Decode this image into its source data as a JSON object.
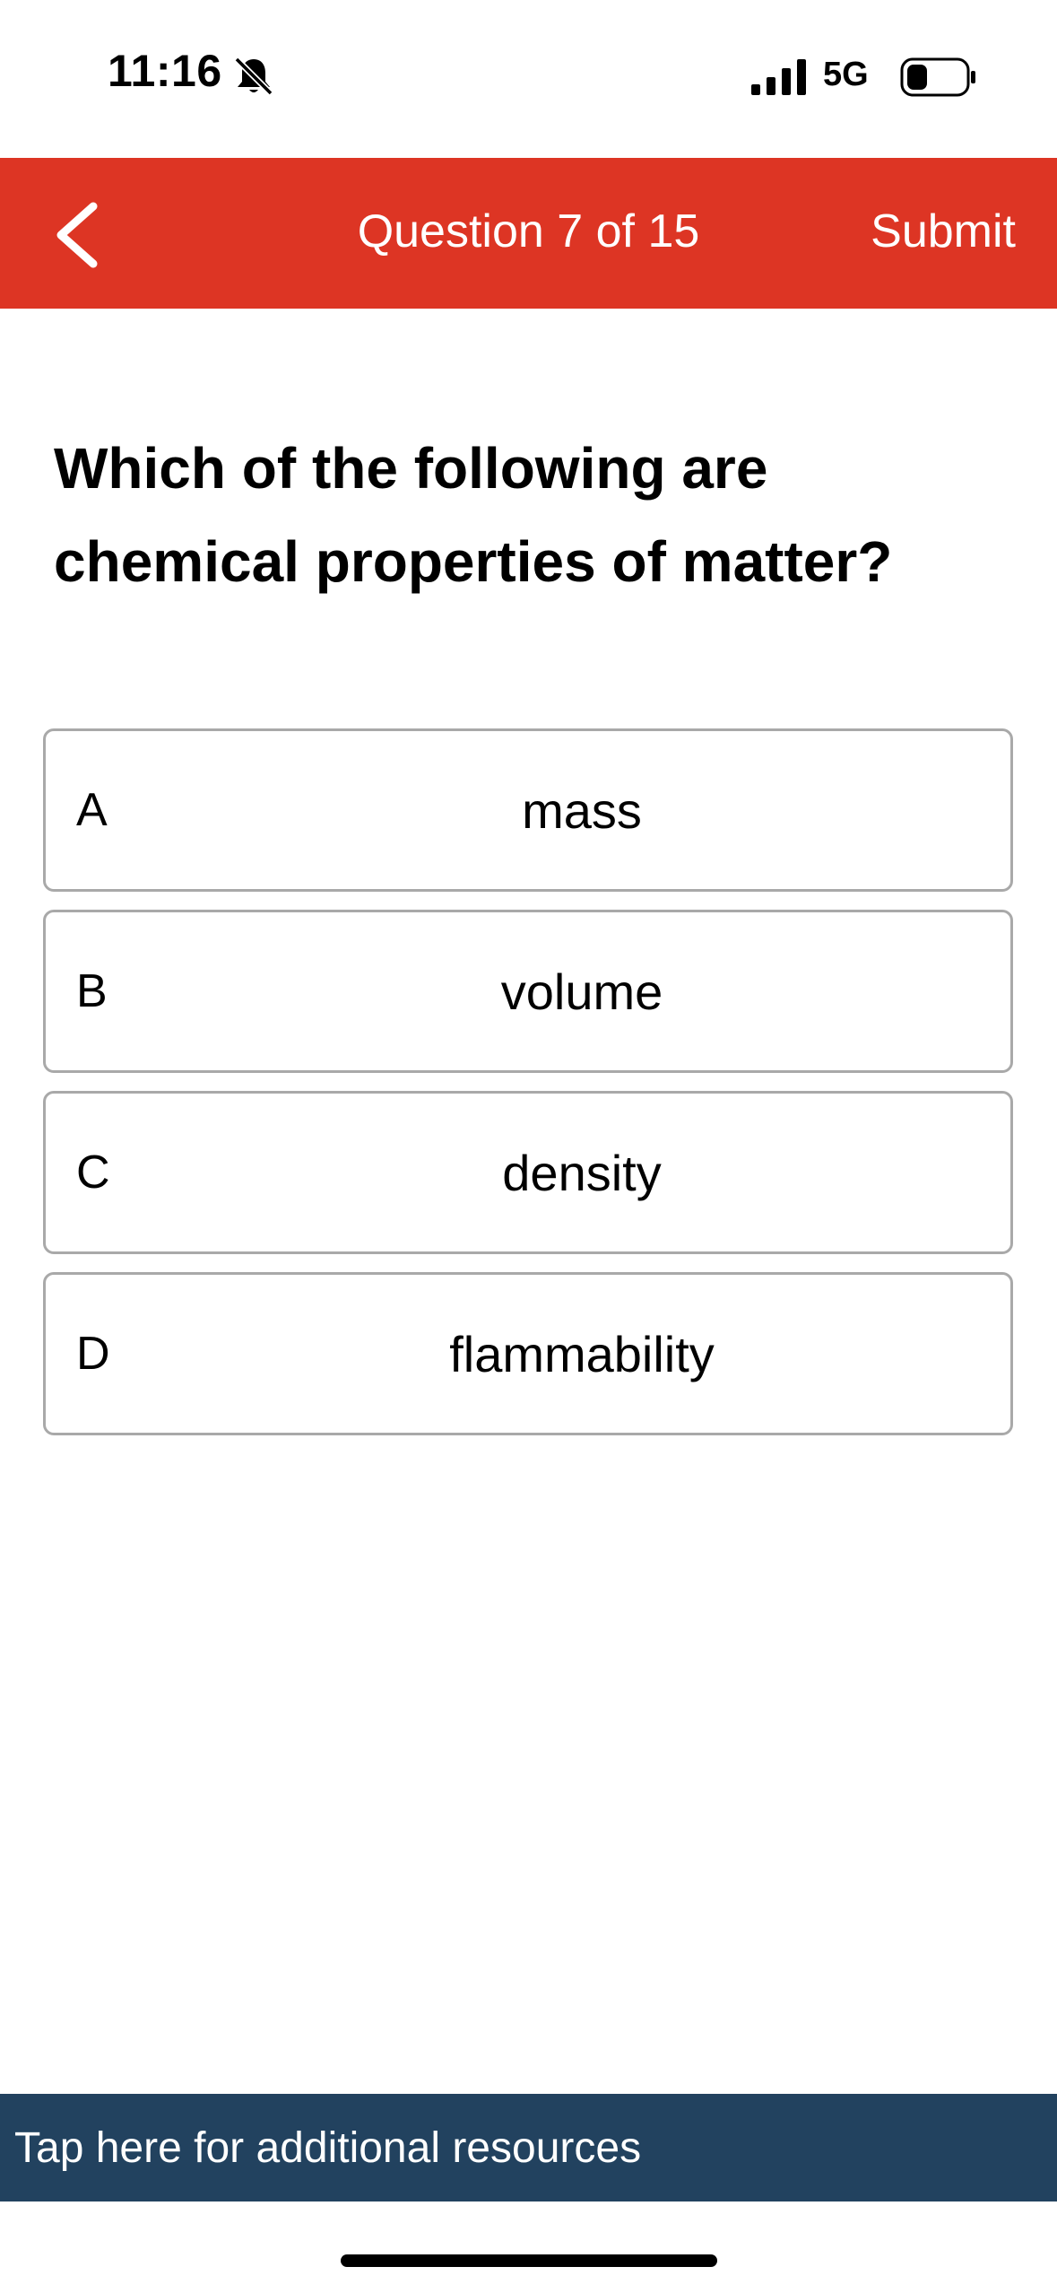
{
  "status_bar": {
    "time": "11:16",
    "network": "5G",
    "icons": [
      "bell-slash-icon",
      "signal-bars-icon",
      "battery-icon"
    ]
  },
  "header": {
    "title": "Question 7 of 15",
    "submit_label": "Submit",
    "background": "#dd3524",
    "back_icon": "chevron-left-icon"
  },
  "question": {
    "text": "Which of the following are chemical properties of matter?"
  },
  "options": [
    {
      "letter": "A",
      "text": "mass"
    },
    {
      "letter": "B",
      "text": "volume"
    },
    {
      "letter": "C",
      "text": "density"
    },
    {
      "letter": "D",
      "text": "flammability"
    }
  ],
  "resources": {
    "label": "Tap here for additional resources",
    "background": "#22425f"
  }
}
